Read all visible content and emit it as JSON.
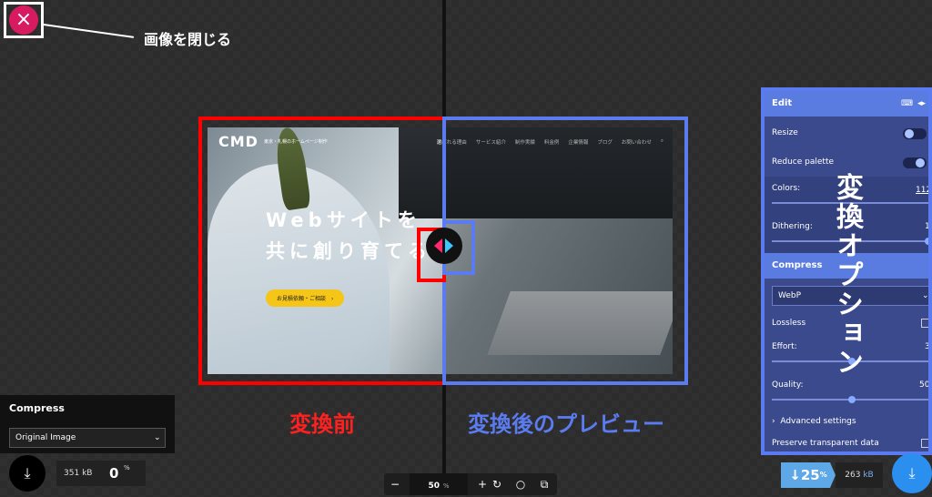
{
  "annotations": {
    "close": "画像を閉じる",
    "before": "変換前",
    "after": "変換後のプレビュー",
    "options": "変換オプション"
  },
  "close_button": {
    "icon": "close-icon",
    "glyph": "×"
  },
  "site": {
    "logo": "CMD",
    "tagline": "東京・札幌のホームページ制作",
    "nav": [
      "選ばれる理由",
      "サービス紹介",
      "制作実績",
      "料金例",
      "企業情報",
      "ブログ",
      "お問い合わせ"
    ],
    "headline_1": "Webサイトを",
    "headline_2": "共に創り育てる",
    "cta": "お見積依頼・ご相談　›"
  },
  "edit_panel": {
    "title": "Edit",
    "resize": "Resize",
    "reduce_palette": "Reduce palette",
    "colors_label": "Colors:",
    "colors_value": "112",
    "dithering_label": "Dithering:",
    "dithering_value": "1",
    "compress_title": "Compress",
    "format": "WebP",
    "lossless": "Lossless",
    "effort_label": "Effort:",
    "effort_value": "3",
    "quality_label": "Quality:",
    "quality_value": "50",
    "advanced": "Advanced settings",
    "preserve": "Preserve transparent data",
    "resize_on": false,
    "reduce_palette_on": true,
    "dithering_level": 1.0,
    "effort_level": 0.5,
    "quality_level": 0.5
  },
  "left_compress": {
    "title": "Compress",
    "selected": "Original Image"
  },
  "left_stats": {
    "size": "351",
    "size_unit": "kB",
    "percent": "0",
    "percent_unit": "%"
  },
  "right_stats": {
    "arrow": "↓",
    "percent": "25",
    "percent_unit": "%",
    "size": "263",
    "size_unit": "kB"
  },
  "toolbar": {
    "zoom_out": "−",
    "zoom": "50",
    "zoom_unit": "%",
    "zoom_in": "+"
  }
}
